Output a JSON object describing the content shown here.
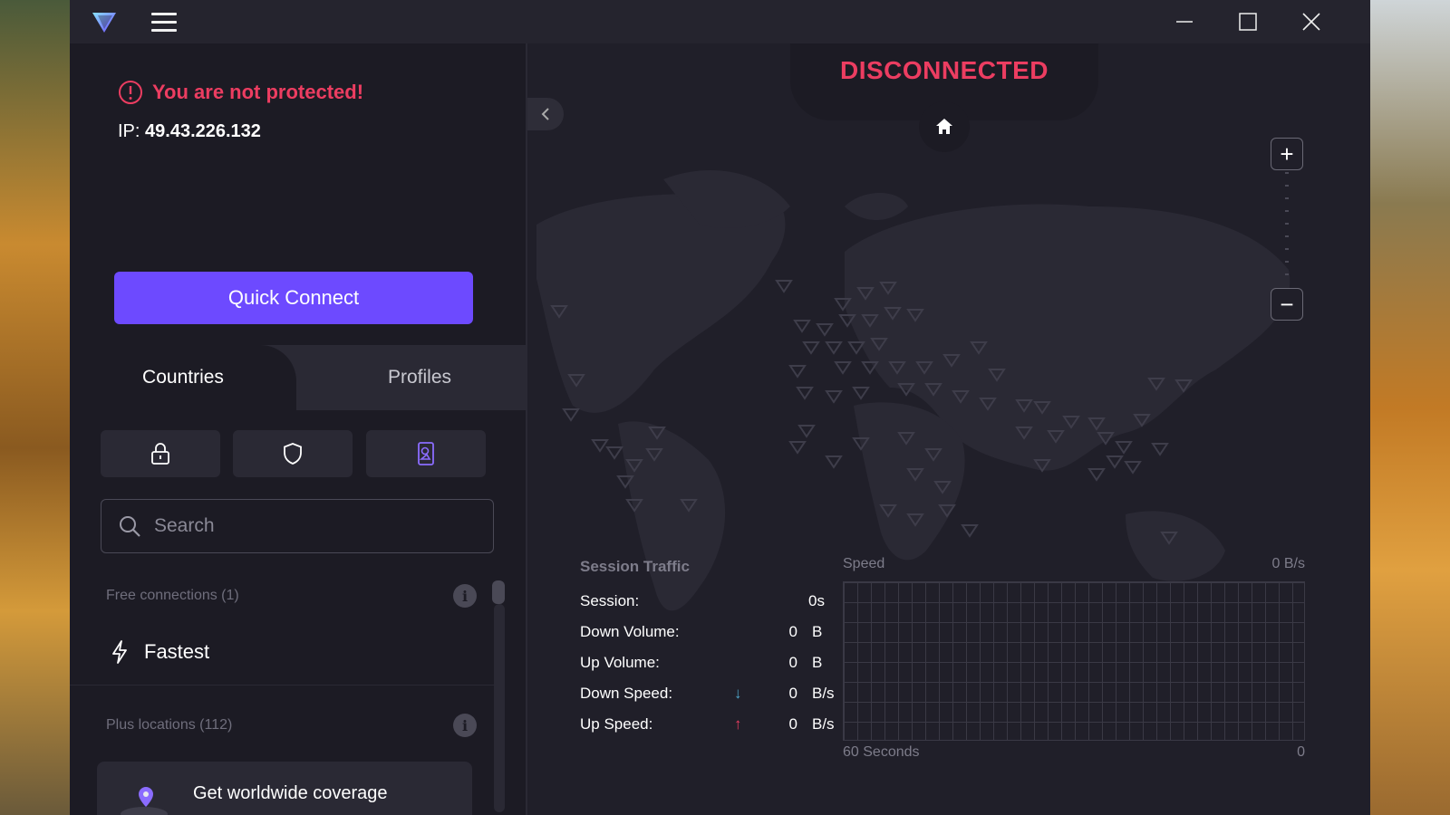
{
  "window": {
    "controls": [
      "minimize",
      "maximize",
      "close"
    ]
  },
  "sidebar": {
    "warning": "You are not protected!",
    "ip_label": "IP:",
    "ip_value": "49.43.226.132",
    "quick_connect": "Quick Connect",
    "tabs": [
      "Countries",
      "Profiles"
    ],
    "filters": [
      "lock-icon",
      "shield-icon",
      "tor-icon"
    ],
    "search_placeholder": "Search",
    "free_section": "Free connections (1)",
    "fastest": "Fastest",
    "plus_section": "Plus locations (112)",
    "promo": "Get worldwide coverage"
  },
  "map": {
    "status": "DISCONNECTED",
    "zoom_in": "+",
    "zoom_out": "−"
  },
  "traffic": {
    "title": "Session Traffic",
    "session_label": "Session:",
    "session_value": "0s",
    "down_volume_label": "Down Volume:",
    "down_volume_value": "0",
    "down_volume_unit": "B",
    "up_volume_label": "Up Volume:",
    "up_volume_value": "0",
    "up_volume_unit": "B",
    "down_speed_label": "Down Speed:",
    "down_speed_value": "0",
    "down_speed_unit": "B/s",
    "up_speed_label": "Up Speed:",
    "up_speed_value": "0",
    "up_speed_unit": "B/s",
    "speed_label": "Speed",
    "speed_value": "0  B/s",
    "axis_left": "60 Seconds",
    "axis_right": "0"
  },
  "colors": {
    "accent": "#6d4aff",
    "danger": "#ec3d61",
    "background": "#1c1b24"
  }
}
